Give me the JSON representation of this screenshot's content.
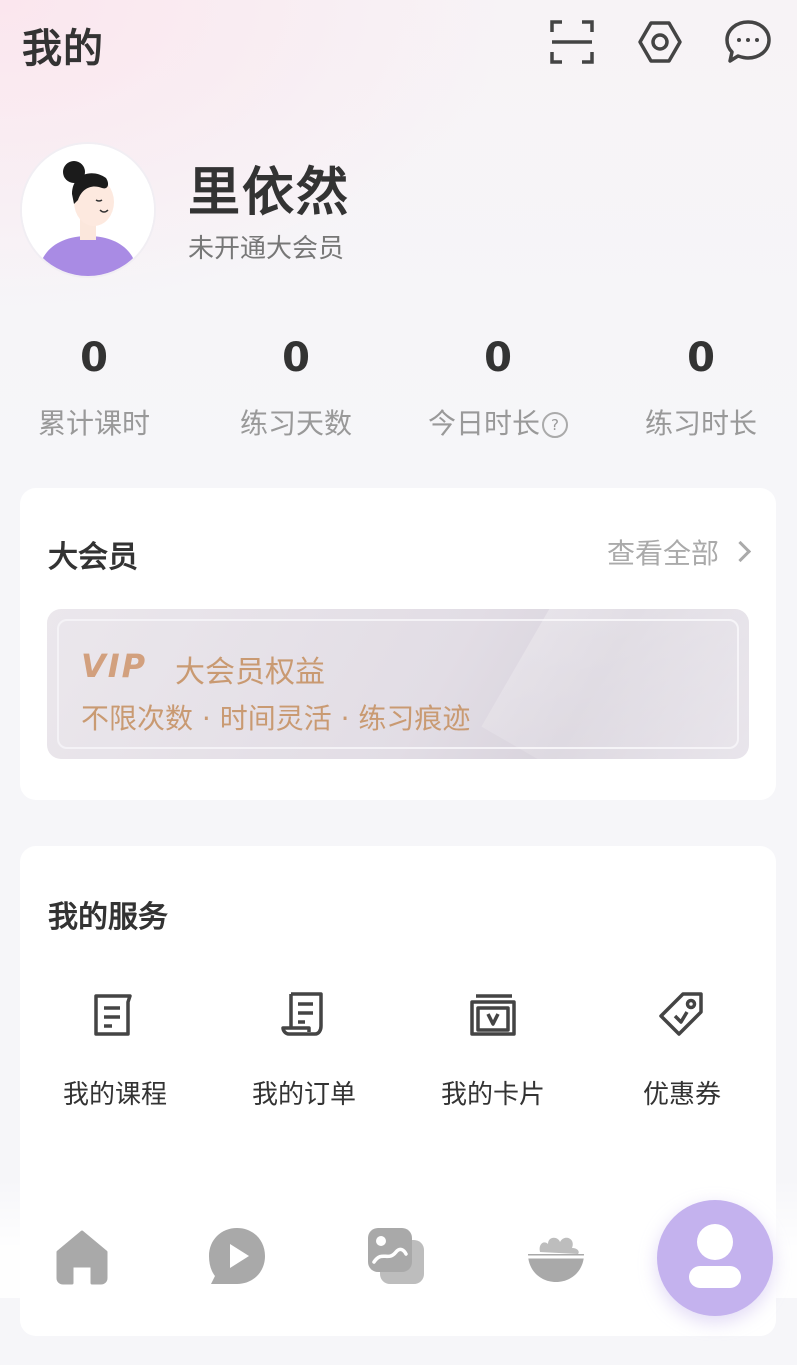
{
  "header": {
    "title": "我的",
    "icons": [
      "scan-icon",
      "settings-icon",
      "message-icon"
    ]
  },
  "profile": {
    "name": "里依然",
    "membership_status": "未开通大会员"
  },
  "stats": [
    {
      "value": "0",
      "label": "累计课时"
    },
    {
      "value": "0",
      "label": "练习天数"
    },
    {
      "value": "0",
      "label": "今日时长",
      "help": "?"
    },
    {
      "value": "0",
      "label": "练习时长"
    }
  ],
  "vip_card": {
    "title": "大会员",
    "view_all": "查看全部",
    "banner": {
      "logo": "VIP",
      "title": "大会员权益",
      "description": "不限次数 · 时间灵活 · 练习痕迹"
    }
  },
  "services": {
    "title": "我的服务",
    "items": [
      {
        "label": "我的课程",
        "icon": "course-icon"
      },
      {
        "label": "我的订单",
        "icon": "order-icon"
      },
      {
        "label": "我的卡片",
        "icon": "card-icon"
      },
      {
        "label": "优惠券",
        "icon": "coupon-icon"
      }
    ]
  },
  "tabbar": {
    "items": [
      {
        "icon": "home-icon"
      },
      {
        "icon": "play-icon"
      },
      {
        "icon": "gallery-icon"
      },
      {
        "icon": "food-bowl-icon"
      },
      {
        "icon": "profile-icon",
        "active": true
      }
    ]
  },
  "colors": {
    "accent": "#c4b2ee",
    "vip_gold": "#c99a72",
    "text_primary": "#333333",
    "text_secondary": "#999999"
  }
}
